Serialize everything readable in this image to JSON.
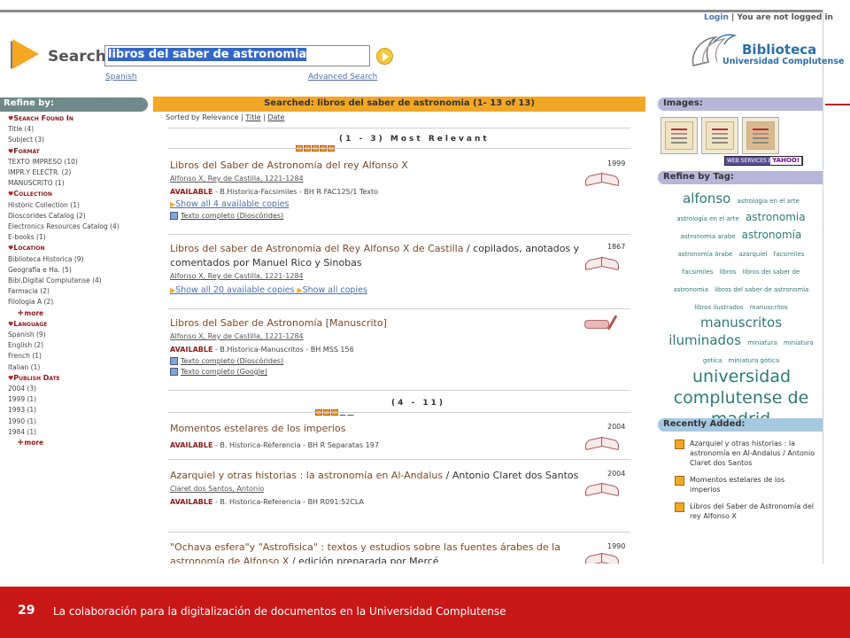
{
  "header": {
    "login_link": "Login",
    "login_status": "You are not logged in",
    "search_label": "Search:",
    "search_value": "libros del saber de astronomia",
    "spanish_link": "Spanish",
    "advanced_link": "Advanced Search",
    "logo_name": "Biblioteca",
    "logo_sub": "Universidad Complutense"
  },
  "refine": {
    "title": "Refine by:",
    "facets": [
      {
        "heading": "Search Found In",
        "items": [
          "Title (4)",
          "Subject (3)"
        ]
      },
      {
        "heading": "Format",
        "items": [
          "TEXTO IMPRESO (10)",
          "IMPR.Y ELECTR. (2)",
          "MANUSCRITO (1)"
        ]
      },
      {
        "heading": "Collection",
        "items": [
          "Historic Collection (1)",
          "Dioscorides Catalog (2)",
          "Electronics Resources Catalog (4)",
          "E-books (1)"
        ]
      },
      {
        "heading": "Location",
        "items": [
          "Biblioteca Historica (9)",
          "Geografia e Ha. (5)",
          "Bibl.Digital Complutense (4)",
          "Farmacia (2)",
          "Filologia A (2)"
        ],
        "more": "more"
      },
      {
        "heading": "Language",
        "items": [
          "Spanish (9)",
          "English (2)",
          "French (1)",
          "Italian (1)"
        ]
      },
      {
        "heading": "Publish Date",
        "items": [
          "2004 (3)",
          "1999 (1)",
          "1993 (1)",
          "1990 (1)",
          "1984 (1)"
        ],
        "more": "more"
      }
    ]
  },
  "results": {
    "searched_title": "Searched: libros del saber de astronomia (1- 13  of 13)",
    "sorted_by": "Sorted by",
    "sort_options": [
      "Relevance",
      "Title",
      "Date"
    ],
    "group1": "(1 - 3) Most Relevant",
    "group2": "(4 - 11)",
    "records": [
      {
        "title": "Libros del Saber de Astronomía del rey Alfonso X",
        "author": "Alfonso X, Rey de Castilla, 1221-1284",
        "year": "1999",
        "availability": "AVAILABLE",
        "location": " - B.Historica-Facsimiles  -  BH R FAC125/1 Texto",
        "link1": "Show all 4 available copies",
        "check1": "Texto completo (Dioscórides)"
      },
      {
        "title": "Libros del saber de Astronomía del Rey Alfonso X de Castilla",
        "title_rest": " / copilados, anotados y comentados por Manuel Rico y Sinobas",
        "author": "Alfonso X, Rey de Castilla, 1221-1284",
        "year": "1867",
        "link1": "Show all 20 available copies",
        "link2": "Show all copies"
      },
      {
        "title": "Libros del Saber de Astronomía [Manuscrito]",
        "author": "Alfonso X, Rey de Castilla, 1221-1284",
        "availability": "AVAILABLE",
        "location": " - B.Historica-Manuscritos  -  BH MSS 156",
        "check1": "Texto completo (Dioscórides)",
        "check2": "Texto completo (Google)"
      },
      {
        "title": "Momentos estelares de los imperios",
        "year": "2004",
        "availability": "AVAILABLE",
        "location": " - B. Historica-Referencia  -  BH R Separatas 197"
      },
      {
        "title": "Azarquiel y otras historias : la astronomía en Al-Andalus",
        "title_rest": " / Antonio Claret dos Santos",
        "author": "Claret dos Santos, Antonio",
        "year": "2004",
        "availability": "AVAILABLE",
        "location": " - B. Historica-Referencia  -  BH R091:52CLA"
      },
      {
        "title": "\"Ochava esfera\"y \"Astrofisica\" : textos y estudios sobre las fuentes árabes de la astronomía de Alfonso X",
        "title_rest": " / edición preparada por Mercé",
        "year": "1990"
      }
    ]
  },
  "right": {
    "images_title": "Images:",
    "yahoo_left": "WEB SERVICES BY",
    "yahoo_right": "YAHOO!",
    "tags_title": "Refine by Tag:",
    "tags": [
      {
        "text": "alfonso",
        "size": 4
      },
      {
        "text": "astrologia en el arte",
        "size": 1
      },
      {
        "text": "astrología en el arte",
        "size": 1
      },
      {
        "text": "astronomia",
        "size": 3
      },
      {
        "text": "astronomia arabe",
        "size": 1
      },
      {
        "text": "astronomía",
        "size": 3
      },
      {
        "text": "astronomía árabe",
        "size": 1
      },
      {
        "text": "azarquiel",
        "size": 1
      },
      {
        "text": "facsimiles",
        "size": 1
      },
      {
        "text": "facsimiles",
        "size": 1
      },
      {
        "text": "libros",
        "size": 1
      },
      {
        "text": "libros del saber de",
        "size": 1
      },
      {
        "text": "astronomia",
        "size": 1
      },
      {
        "text": "libros del saber de astronomía",
        "size": 1
      },
      {
        "text": "libros ilustrados",
        "size": 1
      },
      {
        "text": "manuscritos",
        "size": 1
      },
      {
        "text": "manuscritos",
        "size": 4
      },
      {
        "text": "iluminados",
        "size": 4
      },
      {
        "text": "miniatura",
        "size": 1
      },
      {
        "text": "miniatura",
        "size": 1
      },
      {
        "text": "gotica",
        "size": 1
      },
      {
        "text": "miniatura gótica",
        "size": 1
      },
      {
        "text": "universidad complutense de madrid",
        "size": 5
      }
    ],
    "recent_title": "Recently Added:",
    "recent": [
      "Azarquiel y otras historias : la astronomía en Al-Andalus / Antonio Claret dos Santos",
      "Momentos estelares de los imperios",
      "Libros del Saber de Astronomía del rey Alfonso X"
    ]
  },
  "footer": {
    "slide_number": "29",
    "caption": "La colaboración para la digitalización  de documentos en la Universidad Complutense"
  },
  "colors": {
    "orange": "#f3a623",
    "footer_red": "#c81717",
    "tag_teal": "#2e7a76",
    "refine_gray": "#6f8a88"
  }
}
